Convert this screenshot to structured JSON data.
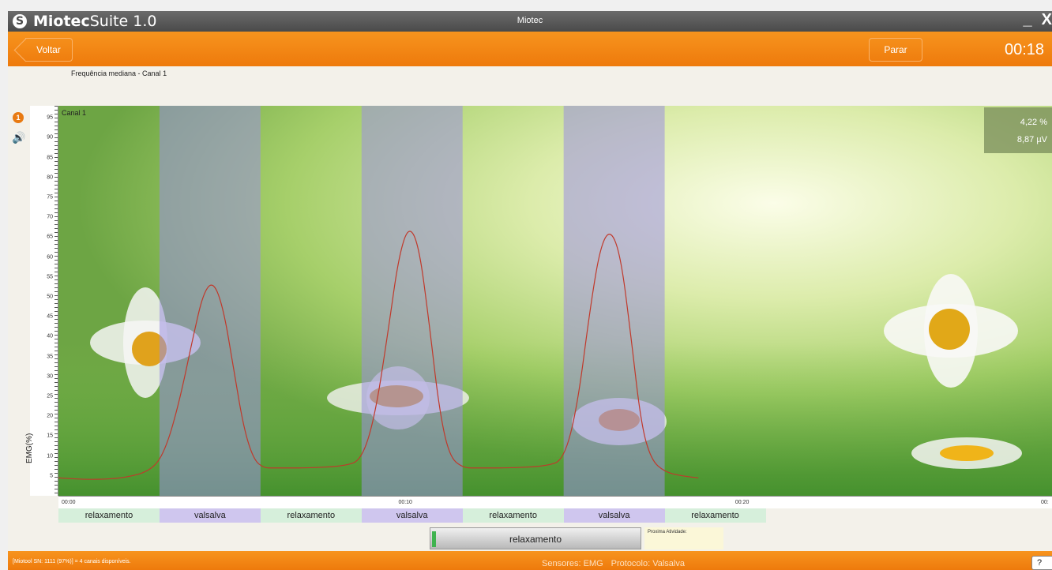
{
  "app": {
    "logo_brand": "Miotec",
    "logo_suite": "Suite 1.0",
    "window_title": "Miotec",
    "minimize": "_",
    "close": "X"
  },
  "toolbar": {
    "back_label": "Voltar",
    "stop_label": "Parar",
    "timer": "00:18"
  },
  "chart_subtitle": "Frequência mediana - Canal 1",
  "channel": {
    "badge": "1",
    "label": "Canal 1",
    "readout_percent": "4,22 %",
    "readout_uv": "8,87 µV"
  },
  "chart_data": {
    "type": "line",
    "ylabel": "EMG(%)",
    "ylim": [
      0,
      98
    ],
    "yticks": [
      5,
      10,
      15,
      20,
      25,
      30,
      35,
      40,
      45,
      50,
      55,
      60,
      65,
      70,
      75,
      80,
      85,
      90,
      95
    ],
    "xlim": [
      0,
      29.5
    ],
    "xticks": [
      {
        "value": 0,
        "label": "00:00"
      },
      {
        "value": 10,
        "label": "00:10"
      },
      {
        "value": 20,
        "label": "00:20"
      },
      {
        "value": 29.5,
        "label": "00:"
      }
    ],
    "series": [
      {
        "color": "#c0392b",
        "x": [
          0,
          1,
          2,
          2.8,
          3.2,
          3.6,
          4.0,
          4.3,
          4.6,
          4.9,
          5.2,
          5.5,
          5.8,
          6.1,
          6.4,
          6.8,
          7.5,
          8.5,
          9.0,
          9.4,
          9.8,
          10.1,
          10.4,
          10.7,
          11.0,
          11.3,
          11.6,
          12.0,
          12.5,
          13.5,
          14.5,
          15.0,
          15.4,
          15.8,
          16.1,
          16.4,
          16.7,
          17.0,
          17.3,
          17.6,
          18.0,
          18.5,
          19.0
        ],
        "y": [
          4.5,
          4.0,
          4.5,
          6.5,
          12,
          24,
          40,
          51,
          54,
          47,
          32,
          17,
          9,
          7,
          7,
          7,
          7,
          7.5,
          9,
          20,
          42,
          60,
          68,
          63,
          44,
          22,
          10,
          7,
          7,
          7,
          7.5,
          9,
          22,
          48,
          63,
          67,
          60,
          40,
          18,
          9,
          6,
          5,
          4.5
        ]
      }
    ],
    "phases": [
      {
        "name": "relaxamento",
        "type": "relax",
        "start": 0,
        "end": 3
      },
      {
        "name": "valsalva",
        "type": "valsalva",
        "start": 3,
        "end": 6
      },
      {
        "name": "relaxamento",
        "type": "relax",
        "start": 6,
        "end": 9
      },
      {
        "name": "valsalva",
        "type": "valsalva",
        "start": 9,
        "end": 12
      },
      {
        "name": "relaxamento",
        "type": "relax",
        "start": 12,
        "end": 15
      },
      {
        "name": "valsalva",
        "type": "valsalva",
        "start": 15,
        "end": 18
      },
      {
        "name": "relaxamento",
        "type": "relax",
        "start": 18,
        "end": 21
      }
    ]
  },
  "activity": {
    "current": "relaxamento",
    "current_progress": 0.02,
    "next_label": "Proxima Atividade:"
  },
  "status": {
    "device": "[Miotool SN: 1111 (97%)] = 4 canais disponíveis.",
    "sensors": "Sensores: EMG",
    "protocol": "Protocolo: Valsalva",
    "help": "?"
  }
}
